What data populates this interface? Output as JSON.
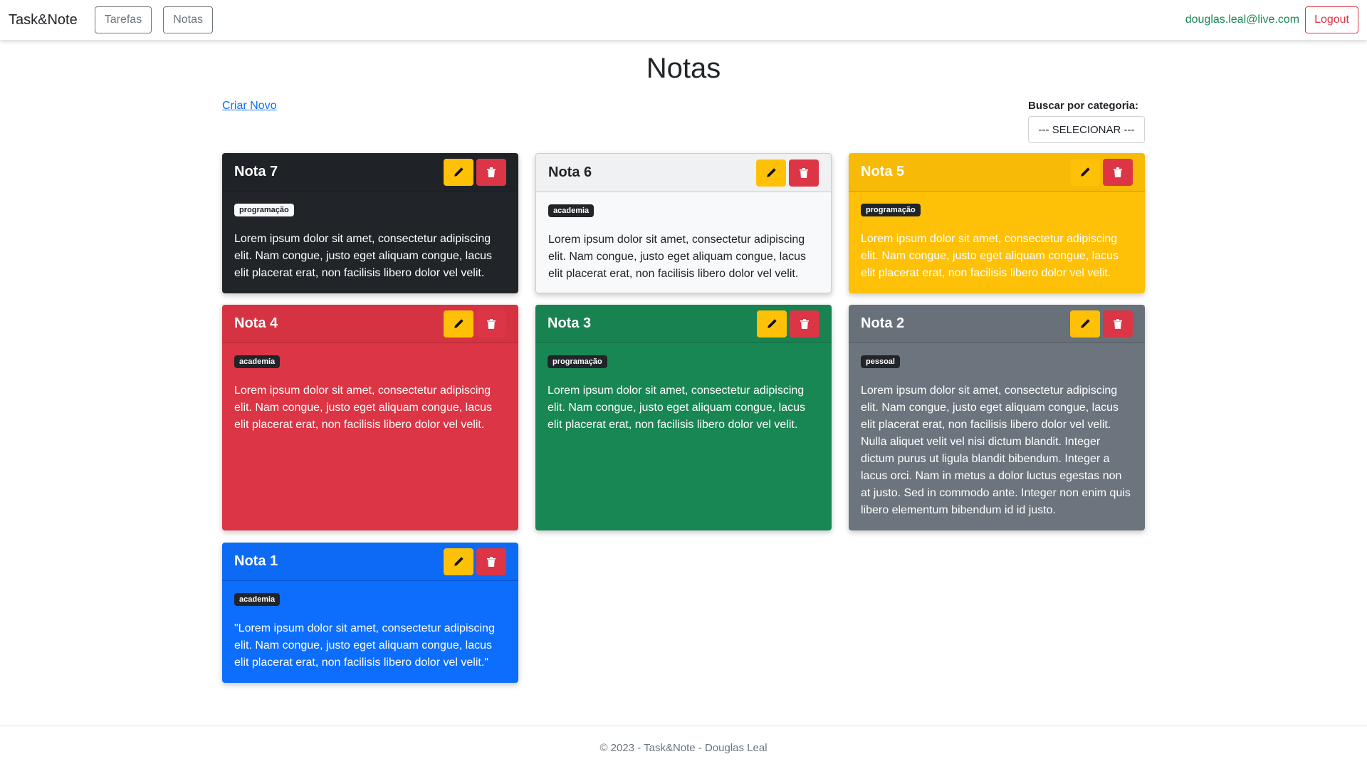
{
  "navbar": {
    "brand": "Task&Note",
    "links": [
      "Tarefas",
      "Notas"
    ],
    "user_email": "douglas.leal@live.com",
    "logout_label": "Logout"
  },
  "page": {
    "title": "Notas",
    "create_link": "Criar Novo",
    "filter_label": "Buscar por categoria:",
    "filter_selected": "--- SELECIONAR ---"
  },
  "icons": {
    "edit": "pencil-icon",
    "delete": "trash-icon"
  },
  "colors": {
    "dark": "#212529",
    "light": "#f8f9fa",
    "warning": "#ffc107",
    "danger": "#dc3545",
    "success": "#198754",
    "secondary": "#6c757d",
    "primary": "#0d6efd"
  },
  "notes": [
    {
      "title": "Nota 7",
      "category": "programação",
      "text": "Lorem ipsum dolor sit amet, consectetur adipiscing elit. Nam congue, justo eget aliquam congue, lacus elit placerat erat, non facilisis libero dolor vel velit."
    },
    {
      "title": "Nota 6",
      "category": "academia",
      "text": "Lorem ipsum dolor sit amet, consectetur adipiscing elit. Nam congue, justo eget aliquam congue, lacus elit placerat erat, non facilisis libero dolor vel velit."
    },
    {
      "title": "Nota 5",
      "category": "programação",
      "text": "Lorem ipsum dolor sit amet, consectetur adipiscing elit. Nam congue, justo eget aliquam congue, lacus elit placerat erat, non facilisis libero dolor vel velit."
    },
    {
      "title": "Nota 4",
      "category": "academia",
      "text": "Lorem ipsum dolor sit amet, consectetur adipiscing elit. Nam congue, justo eget aliquam congue, lacus elit placerat erat, non facilisis libero dolor vel velit."
    },
    {
      "title": "Nota 3",
      "category": "programação",
      "text": "Lorem ipsum dolor sit amet, consectetur adipiscing elit. Nam congue, justo eget aliquam congue, lacus elit placerat erat, non facilisis libero dolor vel velit."
    },
    {
      "title": "Nota 2",
      "category": "pessoal",
      "text": "Lorem ipsum dolor sit amet, consectetur adipiscing elit. Nam congue, justo eget aliquam congue, lacus elit placerat erat, non facilisis libero dolor vel velit. Nulla aliquet velit vel nisi dictum blandit. Integer dictum purus ut ligula blandit bibendum. Integer a lacus orci. Nam in metus a dolor luctus egestas non at justo. Sed in commodo ante. Integer non enim quis libero elementum bibendum id id justo."
    },
    {
      "title": "Nota 1",
      "category": "academia",
      "text": "\"Lorem ipsum dolor sit amet, consectetur adipiscing elit. Nam congue, justo eget aliquam congue, lacus elit placerat erat, non facilisis libero dolor vel velit.\""
    }
  ],
  "footer": {
    "text": "© 2023 - Task&Note - Douglas Leal"
  }
}
